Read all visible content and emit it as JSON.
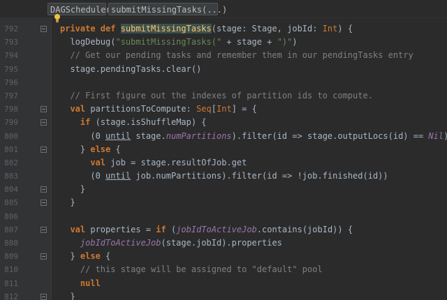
{
  "breadcrumb": {
    "items": [
      "DAGScheduler",
      "submitMissingTasks(...)"
    ]
  },
  "colors": {
    "background": "#2b2b2b",
    "keyword": "#cc7832",
    "function": "#ffc66d",
    "string": "#6a8759",
    "comment": "#808080",
    "field": "#9876aa"
  },
  "icons": {
    "lightbulb": "lightbulb-icon",
    "fold": "fold-marker-icon"
  },
  "code_lines": [
    {
      "n": "792",
      "fold": true,
      "tokens": [
        {
          "t": "private def ",
          "c": "kw"
        },
        {
          "t": "submitMissingTasks",
          "c": "hl-fn"
        },
        {
          "t": "(stage: Stage, jobId: ",
          "c": ""
        },
        {
          "t": "Int",
          "c": "ty"
        },
        {
          "t": ") {",
          "c": ""
        }
      ]
    },
    {
      "n": "793",
      "fold": false,
      "tokens": [
        {
          "t": "  logDebug(",
          "c": ""
        },
        {
          "t": "\"submitMissingTasks(\"",
          "c": "str"
        },
        {
          "t": " + stage + ",
          "c": ""
        },
        {
          "t": "\")\"",
          "c": "str"
        },
        {
          "t": ")",
          "c": ""
        }
      ]
    },
    {
      "n": "794",
      "fold": false,
      "tokens": [
        {
          "t": "  // Get our pending tasks and remember them in our pendingTasks entry",
          "c": "cm"
        }
      ]
    },
    {
      "n": "795",
      "fold": false,
      "tokens": [
        {
          "t": "  stage.pendingTasks.clear()",
          "c": ""
        }
      ]
    },
    {
      "n": "796",
      "fold": false,
      "tokens": []
    },
    {
      "n": "797",
      "fold": false,
      "tokens": [
        {
          "t": "  // First figure out the indexes of partition ids to compute.",
          "c": "cm"
        }
      ]
    },
    {
      "n": "798",
      "fold": true,
      "tokens": [
        {
          "t": "  ",
          "c": ""
        },
        {
          "t": "val ",
          "c": "kw"
        },
        {
          "t": "partitionsToCompute: ",
          "c": ""
        },
        {
          "t": "Seq",
          "c": "ty"
        },
        {
          "t": "[",
          "c": ""
        },
        {
          "t": "Int",
          "c": "ty"
        },
        {
          "t": "] = {",
          "c": ""
        }
      ]
    },
    {
      "n": "799",
      "fold": true,
      "tokens": [
        {
          "t": "    ",
          "c": ""
        },
        {
          "t": "if ",
          "c": "kw"
        },
        {
          "t": "(stage.isShuffleMap) {",
          "c": ""
        }
      ]
    },
    {
      "n": "800",
      "fold": false,
      "tokens": [
        {
          "t": "      (0 ",
          "c": ""
        },
        {
          "t": "until",
          "c": "ul"
        },
        {
          "t": " stage.",
          "c": ""
        },
        {
          "t": "numPartitions",
          "c": "it"
        },
        {
          "t": ").filter(id => stage.outputLocs(id) == ",
          "c": ""
        },
        {
          "t": "Nil",
          "c": "it"
        },
        {
          "t": ")",
          "c": ""
        }
      ]
    },
    {
      "n": "801",
      "fold": true,
      "tokens": [
        {
          "t": "    } ",
          "c": ""
        },
        {
          "t": "else ",
          "c": "kw"
        },
        {
          "t": "{",
          "c": ""
        }
      ]
    },
    {
      "n": "802",
      "fold": false,
      "tokens": [
        {
          "t": "      ",
          "c": ""
        },
        {
          "t": "val ",
          "c": "kw"
        },
        {
          "t": "job = stage.resultOfJob.get",
          "c": ""
        }
      ]
    },
    {
      "n": "803",
      "fold": false,
      "tokens": [
        {
          "t": "      (0 ",
          "c": ""
        },
        {
          "t": "until",
          "c": "ul"
        },
        {
          "t": " job.numPartitions).filter(id => !job.finished(id))",
          "c": ""
        }
      ]
    },
    {
      "n": "804",
      "fold": true,
      "tokens": [
        {
          "t": "    }",
          "c": ""
        }
      ]
    },
    {
      "n": "805",
      "fold": true,
      "tokens": [
        {
          "t": "  }",
          "c": ""
        }
      ]
    },
    {
      "n": "806",
      "fold": false,
      "tokens": []
    },
    {
      "n": "807",
      "fold": true,
      "tokens": [
        {
          "t": "  ",
          "c": ""
        },
        {
          "t": "val ",
          "c": "kw"
        },
        {
          "t": "properties = ",
          "c": ""
        },
        {
          "t": "if ",
          "c": "kw"
        },
        {
          "t": "(",
          "c": ""
        },
        {
          "t": "jobIdToActiveJob",
          "c": "it"
        },
        {
          "t": ".contains(jobId)) {",
          "c": ""
        }
      ]
    },
    {
      "n": "808",
      "fold": false,
      "tokens": [
        {
          "t": "    ",
          "c": ""
        },
        {
          "t": "jobIdToActiveJob",
          "c": "it"
        },
        {
          "t": "(stage.jobId).properties",
          "c": ""
        }
      ]
    },
    {
      "n": "809",
      "fold": true,
      "tokens": [
        {
          "t": "  } ",
          "c": ""
        },
        {
          "t": "else ",
          "c": "kw"
        },
        {
          "t": "{",
          "c": ""
        }
      ]
    },
    {
      "n": "810",
      "fold": false,
      "tokens": [
        {
          "t": "    // this stage will be assigned to \"default\" pool",
          "c": "cm"
        }
      ]
    },
    {
      "n": "811",
      "fold": false,
      "tokens": [
        {
          "t": "    ",
          "c": ""
        },
        {
          "t": "null",
          "c": "kw"
        }
      ]
    },
    {
      "n": "812",
      "fold": true,
      "tokens": [
        {
          "t": "  }",
          "c": ""
        }
      ]
    }
  ]
}
